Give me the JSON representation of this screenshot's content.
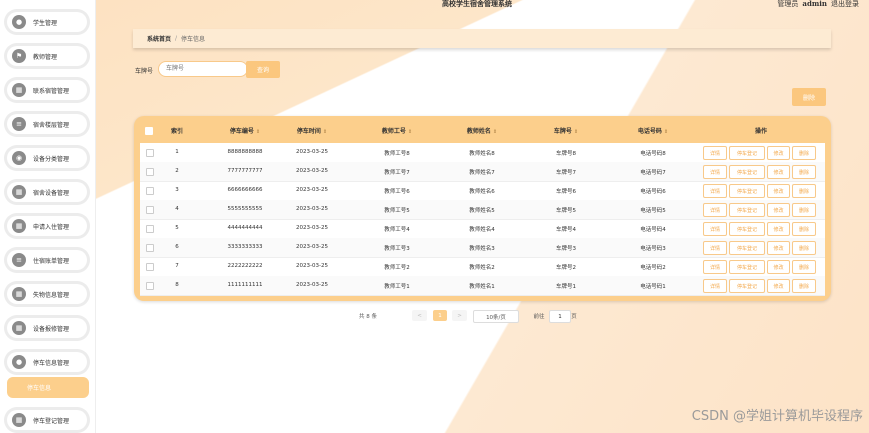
{
  "header": {
    "system_title": "高校学生宿舍管理系统",
    "role": "管理员",
    "username": "admin",
    "logout": "退出登录"
  },
  "sidebar": {
    "items": [
      {
        "label": "学生管理",
        "icon": "person-icon"
      },
      {
        "label": "教师管理",
        "icon": "flag-icon"
      },
      {
        "label": "联系宿管管理",
        "icon": "grid-icon"
      },
      {
        "label": "宿舍楼层管理",
        "icon": "list-icon"
      },
      {
        "label": "设备分类管理",
        "icon": "location-icon"
      },
      {
        "label": "宿舍设备管理",
        "icon": "grid-icon"
      },
      {
        "label": "申请入住管理",
        "icon": "grid-icon"
      },
      {
        "label": "住宿账单管理",
        "icon": "list-icon"
      },
      {
        "label": "失物信息管理",
        "icon": "grid-icon"
      },
      {
        "label": "设备报修管理",
        "icon": "grid-icon"
      },
      {
        "label": "停车信息管理",
        "icon": "person-icon"
      },
      {
        "label": "停车登记管理",
        "icon": "grid-icon"
      }
    ],
    "active_sub": "停车信息"
  },
  "breadcrumb": {
    "home": "系统首页",
    "separator": "/",
    "current": "停车信息"
  },
  "search": {
    "label": "车牌号",
    "placeholder": "车牌号",
    "button": "查询"
  },
  "toolbar": {
    "delete": "删除"
  },
  "table": {
    "headers": [
      "索引",
      "停车编号",
      "停车时间",
      "教师工号",
      "教师姓名",
      "车牌号",
      "电话号码",
      "操作"
    ],
    "actions": [
      "详情",
      "停车登记",
      "修改",
      "删除"
    ],
    "rows": [
      [
        "1",
        "8888888888",
        "2023-03-25",
        "教师工号8",
        "教师姓名8",
        "车牌号8",
        "电话号码8"
      ],
      [
        "2",
        "7777777777",
        "2023-03-25",
        "教师工号7",
        "教师姓名7",
        "车牌号7",
        "电话号码7"
      ],
      [
        "3",
        "6666666666",
        "2023-03-25",
        "教师工号6",
        "教师姓名6",
        "车牌号6",
        "电话号码6"
      ],
      [
        "4",
        "5555555555",
        "2023-03-25",
        "教师工号5",
        "教师姓名5",
        "车牌号5",
        "电话号码5"
      ],
      [
        "5",
        "4444444444",
        "2023-03-25",
        "教师工号4",
        "教师姓名4",
        "车牌号4",
        "电话号码4"
      ],
      [
        "6",
        "3333333333",
        "2023-03-25",
        "教师工号3",
        "教师姓名3",
        "车牌号3",
        "电话号码3"
      ],
      [
        "7",
        "2222222222",
        "2023-03-25",
        "教师工号2",
        "教师姓名2",
        "车牌号2",
        "电话号码2"
      ],
      [
        "8",
        "1111111111",
        "2023-03-25",
        "教师工号1",
        "教师姓名1",
        "车牌号1",
        "电话号码1"
      ]
    ]
  },
  "pagination": {
    "total": "共 8 条",
    "prev": "<",
    "current_page": "1",
    "next": ">",
    "page_size": "10条/页",
    "goto_label": "前往",
    "goto_value": "1",
    "page_unit": "页"
  },
  "watermark": "CSDN @学姐计算机毕设程序",
  "colors": {
    "accent": "#fccf8c",
    "button": "#fbc77e",
    "action_text": "#f3a94d"
  }
}
